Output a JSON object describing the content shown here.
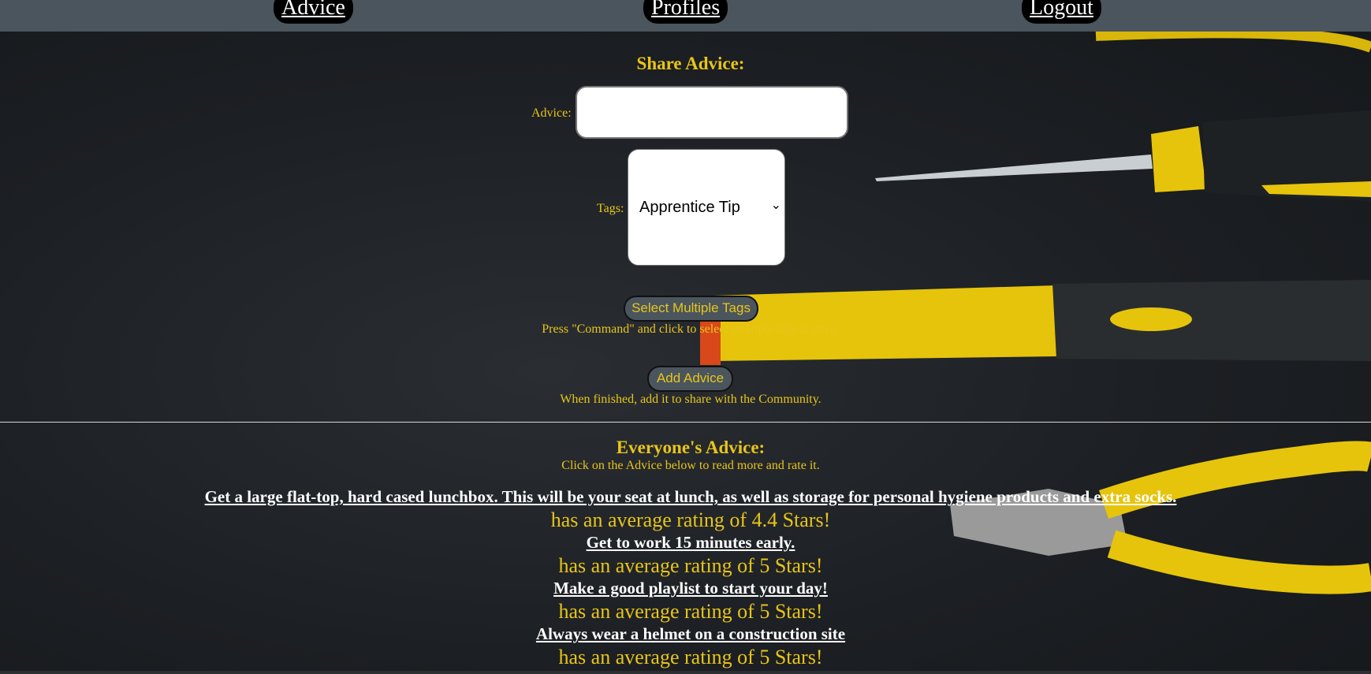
{
  "nav": {
    "advice": "Advice",
    "profiles": "Profiles",
    "logout": "Logout"
  },
  "share": {
    "title": "Share Advice:",
    "advice_label": "Advice:",
    "advice_value": "",
    "tags_label": "Tags:",
    "tags_selected": "Apprentice Tip",
    "select_multiple_button": "Select Multiple Tags",
    "select_multiple_hint": "Press \"Command\" and click to select multiple tags at once.",
    "add_button": "Add Advice",
    "add_hint": "When finished, add it to share with the Community."
  },
  "everyone": {
    "title": "Everyone's Advice:",
    "subtitle": "Click on the Advice below to read more and rate it.",
    "items": [
      {
        "text": "Get a large flat-top, hard cased lunchbox. This will be your seat at lunch, as well as storage for personal hygiene products and extra socks.",
        "rating": "has an average rating of 4.4 Stars!"
      },
      {
        "text": "Get to work 15 minutes early.",
        "rating": "has an average rating of 5 Stars!"
      },
      {
        "text": "Make a good playlist to start your day!",
        "rating": "has an average rating of 5 Stars!"
      },
      {
        "text": "Always wear a helmet on a construction site",
        "rating": "has an average rating of 5 Stars!"
      }
    ]
  },
  "colors": {
    "accent": "#e8c51a",
    "nav_bar": "#4b555e",
    "link": "#ffffff"
  }
}
